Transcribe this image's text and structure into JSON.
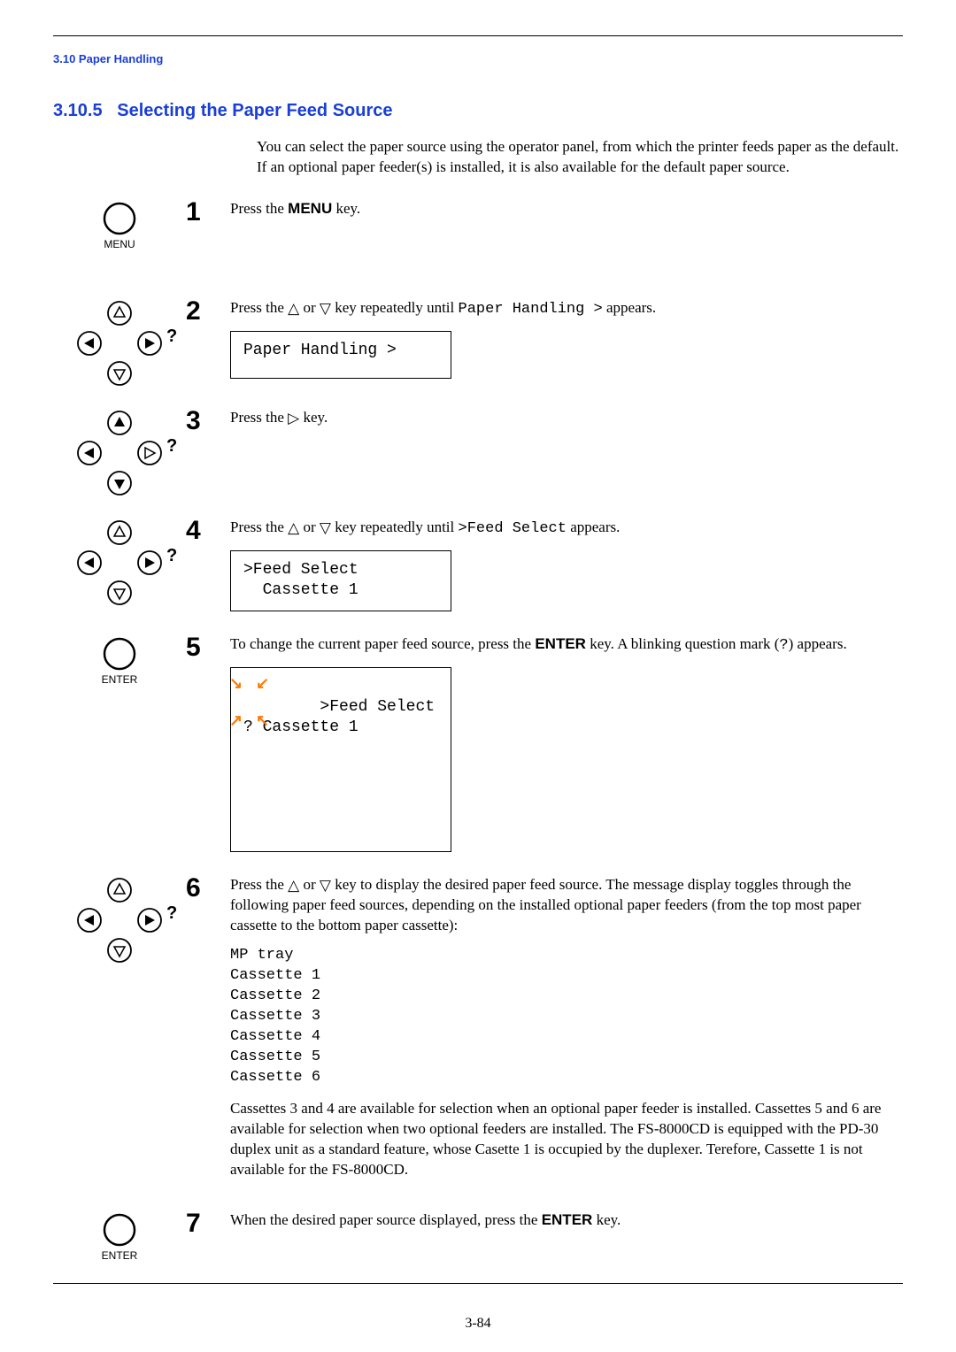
{
  "header": {
    "running": "3.10 Paper Handling"
  },
  "section": {
    "number": "3.10.5",
    "title": "Selecting the Paper Feed Source",
    "intro": "You can select the paper source using the operator panel, from which the printer feeds paper as the default. If an optional paper feeder(s) is installed, it is also available for the default paper source."
  },
  "symbols": {
    "tri_up": "△",
    "tri_down": "▽",
    "tri_right": "▷"
  },
  "keys": {
    "menu": "MENU",
    "enter": "ENTER"
  },
  "icon_labels": {
    "menu_caption": "MENU",
    "enter_caption": "ENTER"
  },
  "steps": {
    "s1": {
      "num": "1",
      "text_a": "Press the ",
      "text_b": " key."
    },
    "s2": {
      "num": "2",
      "text_a": "Press the ",
      "text_b": " or ",
      "text_c": " key repeatedly until ",
      "text_mono": "Paper Handling  >",
      "text_d": " appears.",
      "lcd": "Paper Handling >"
    },
    "s3": {
      "num": "3",
      "text_a": "Press the ",
      "text_b": " key."
    },
    "s4": {
      "num": "4",
      "text_a": "Press the ",
      "text_b": " or ",
      "text_c": " key repeatedly until ",
      "text_mono": ">Feed Select",
      "text_d": " appears.",
      "lcd": ">Feed Select\n  Cassette 1"
    },
    "s5": {
      "num": "5",
      "text_a": "To change the current paper feed source, press the ",
      "text_b": " key. A blinking question mark (",
      "text_mono_q": "?",
      "text_c": ") appears.",
      "lcd": ">Feed Select\n? Cassette 1"
    },
    "s6": {
      "num": "6",
      "text_a": "Press the ",
      "text_b": " or ",
      "text_c": " key to display the desired paper feed source. The message display toggles through the following paper feed sources, depending on the installed optional paper feeders (from the top most paper cassette to the bottom paper cassette):",
      "list": "MP tray\nCassette 1\nCassette 2\nCassette 3\nCassette 4\nCassette 5\nCassette 6",
      "note": "Cassettes 3 and 4 are available for selection when an optional paper feeder is installed. Cassettes 5 and 6 are available for selection when two optional feeders are installed. The FS-8000CD is equipped with the PD-30 duplex unit as a standard feature, whose Casette 1 is occupied by the duplexer. Terefore, Cassette 1 is not available for the FS-8000CD."
    },
    "s7": {
      "num": "7",
      "text_a": "When the desired paper source displayed, press the ",
      "text_b": " key."
    }
  },
  "footer": {
    "page": "3-84"
  }
}
